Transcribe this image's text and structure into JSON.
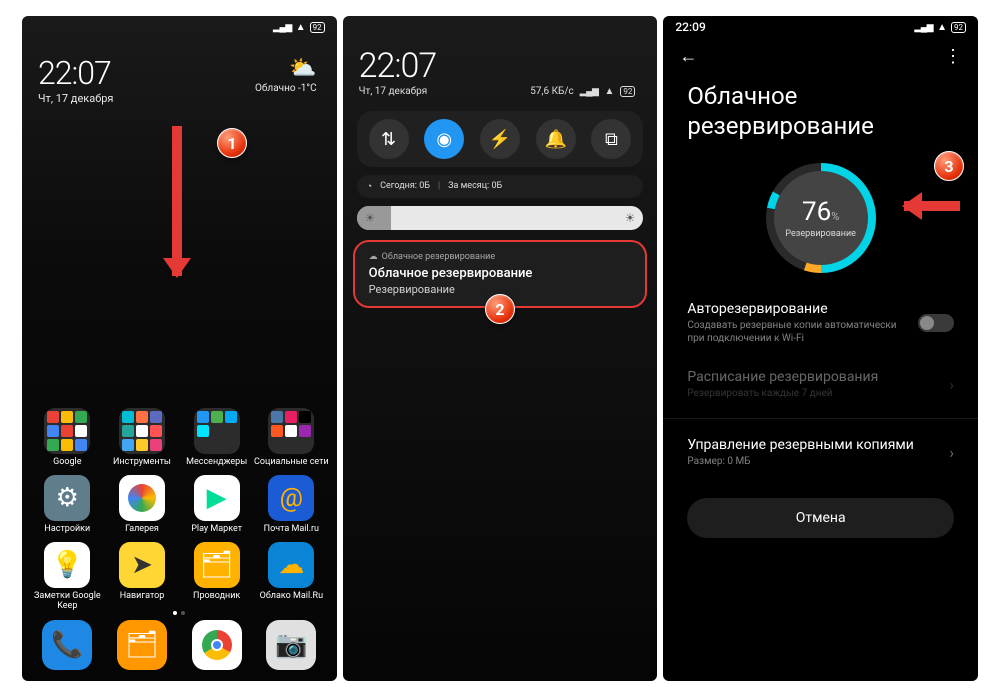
{
  "status": {
    "signal": "▂▄▆",
    "wifi": "◈",
    "battery": "92"
  },
  "screen1": {
    "time": "22:07",
    "date": "Чт, 17 декабря",
    "weather_cond": "Облачно",
    "weather_temp": "-1°C",
    "folders": [
      "Google",
      "Инструменты",
      "Мессенджеры",
      "Социальные сети"
    ],
    "apps": [
      {
        "label": "Настройки",
        "color": "#fff",
        "glyph": "⚙"
      },
      {
        "label": "Галерея",
        "color": "#fff",
        "glyph": "◕"
      },
      {
        "label": "Play Маркет",
        "color": "#fff",
        "glyph": "▶"
      },
      {
        "label": "Почта Mail.ru",
        "color": "#1b5bd4",
        "glyph": "@"
      },
      {
        "label": "Заметки Google Keep",
        "color": "#fff",
        "glyph": "💡"
      },
      {
        "label": "Навигатор",
        "color": "#ffd633",
        "glyph": "➤"
      },
      {
        "label": "Проводник",
        "color": "#ffb300",
        "glyph": "🗂"
      },
      {
        "label": "Облако Mail.Ru",
        "color": "#0a84d4",
        "glyph": "☁"
      }
    ],
    "dock": [
      {
        "color": "#1e88e5",
        "glyph": "📞"
      },
      {
        "color": "#ff9800",
        "glyph": "🗂"
      },
      {
        "color": "#fff",
        "glyph": "◉"
      },
      {
        "color": "#e0e0e0",
        "glyph": "📷"
      }
    ]
  },
  "screen2": {
    "time": "22:07",
    "date": "Чт, 17 декабря",
    "net_speed": "57,6 КБ/с",
    "usage_today": "Сегодня: 0Б",
    "usage_month": "За месяц: 0Б",
    "notif_source": "Облачное резервирование",
    "notif_title": "Облачное резервирование",
    "notif_body": "Резервирование"
  },
  "screen3": {
    "time": "22:09",
    "title": "Облачное резервирование",
    "progress": "76",
    "progress_label": "Резервирование",
    "auto_label": "Авторезервирование",
    "auto_sub": "Создавать резервные копии автоматически при подключении к Wi-Fi",
    "schedule_label": "Расписание резервирования",
    "schedule_sub": "Резервировать каждые 7 дней",
    "manage_label": "Управление резервными копиями",
    "manage_sub": "Размер: 0 МБ",
    "cancel": "Отмена"
  },
  "badges": {
    "b1": "1",
    "b2": "2",
    "b3": "3"
  }
}
